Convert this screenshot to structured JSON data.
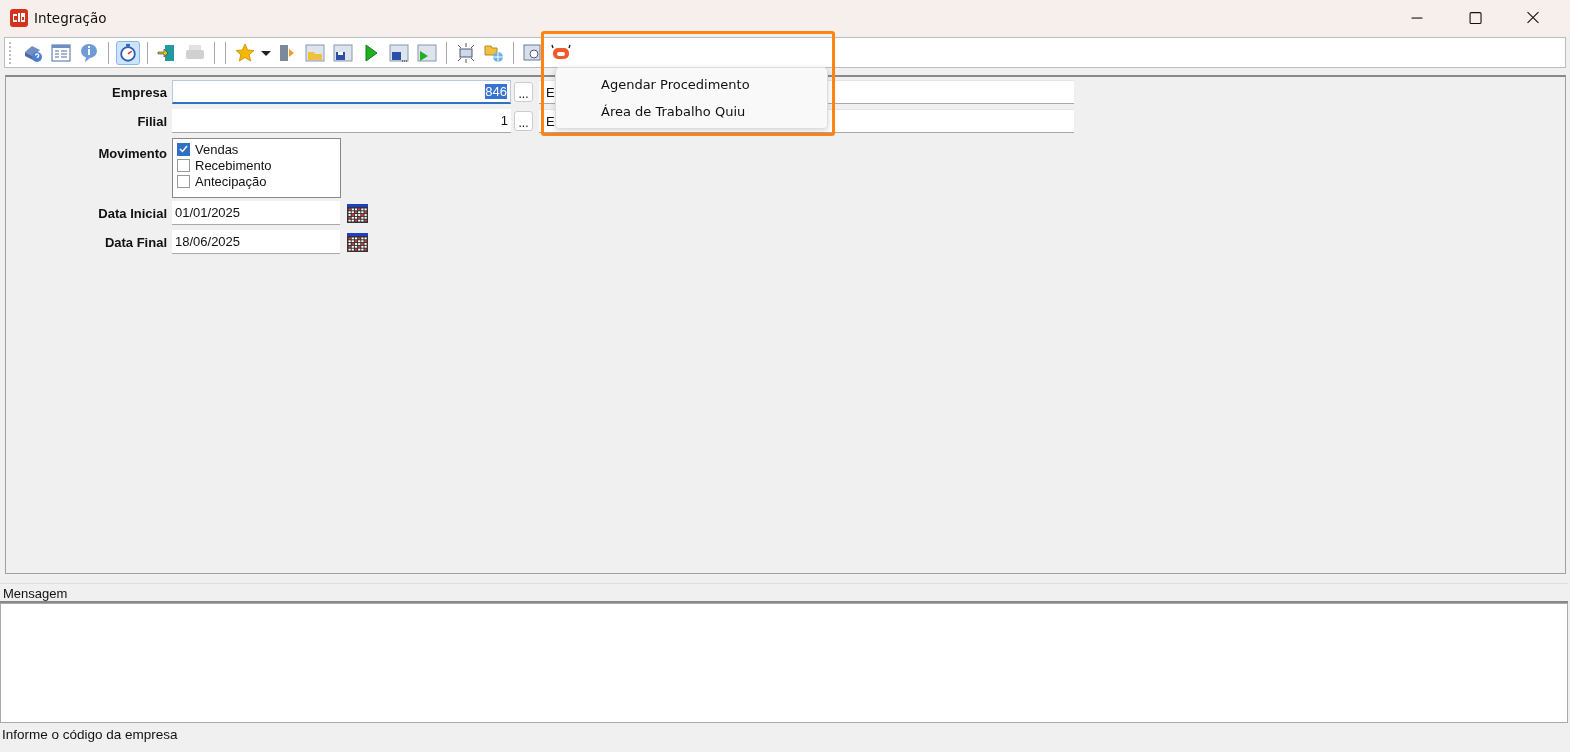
{
  "window": {
    "title": "Integração"
  },
  "toolbar": [
    {
      "kind": "help",
      "selected": false,
      "disabled": false
    },
    {
      "kind": "form",
      "selected": false,
      "disabled": false
    },
    {
      "kind": "info",
      "selected": false,
      "disabled": false
    },
    {
      "kind": "sep"
    },
    {
      "kind": "timer",
      "selected": true,
      "disabled": false
    },
    {
      "kind": "sep"
    },
    {
      "kind": "exit",
      "selected": false,
      "disabled": false
    },
    {
      "kind": "print",
      "selected": false,
      "disabled": true
    },
    {
      "kind": "sep"
    },
    {
      "kind": "sep"
    },
    {
      "kind": "star",
      "selected": false,
      "disabled": false
    },
    {
      "kind": "caret",
      "selected": false,
      "disabled": false
    },
    {
      "kind": "door",
      "selected": false,
      "disabled": false
    },
    {
      "kind": "open",
      "selected": false,
      "disabled": false
    },
    {
      "kind": "save",
      "selected": false,
      "disabled": false
    },
    {
      "kind": "run",
      "selected": false,
      "disabled": false
    },
    {
      "kind": "saveall",
      "selected": false,
      "disabled": false
    },
    {
      "kind": "runform",
      "selected": false,
      "disabled": false
    },
    {
      "kind": "sep"
    },
    {
      "kind": "target",
      "selected": false,
      "disabled": false
    },
    {
      "kind": "folder",
      "selected": false,
      "disabled": false
    },
    {
      "kind": "sep"
    },
    {
      "kind": "preview",
      "selected": false,
      "disabled": false
    },
    {
      "kind": "robot",
      "selected": false,
      "disabled": false
    }
  ],
  "menu": {
    "items": [
      {
        "label": "Agendar Procedimento"
      },
      {
        "label": "Área de Trabalho Quiu"
      }
    ]
  },
  "form": {
    "rows": [
      {
        "kind": "lookup",
        "label": "Empresa",
        "value": "846",
        "focused": true,
        "button": "...",
        "description": "E"
      },
      {
        "kind": "lookup",
        "label": "Filial",
        "value": "1",
        "focused": false,
        "button": "...",
        "description": "E"
      },
      {
        "kind": "checklist",
        "label": "Movimento",
        "options": [
          {
            "label": "Vendas",
            "checked": true
          },
          {
            "label": "Recebimento",
            "checked": false
          },
          {
            "label": "Antecipação",
            "checked": false
          }
        ]
      },
      {
        "kind": "date",
        "label": "Data Inicial",
        "value": "01/01/2025"
      },
      {
        "kind": "date",
        "label": "Data Final",
        "value": "18/06/2025"
      }
    ]
  },
  "messages": {
    "title": "Mensagem"
  },
  "status_bar": {
    "text": "Informe o código da empresa"
  }
}
